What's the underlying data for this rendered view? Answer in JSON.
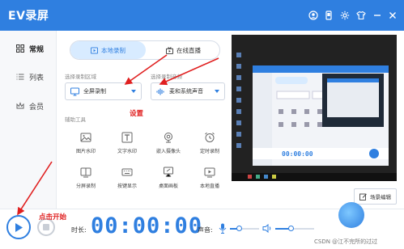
{
  "app": {
    "title": "EV录屏"
  },
  "titlebar": {
    "icons": [
      "user-icon",
      "phone-icon",
      "gear-icon",
      "shirt-icon",
      "minimize-icon",
      "close-icon"
    ]
  },
  "sidebar": {
    "items": [
      {
        "label": "常规",
        "icon": "grid-icon",
        "active": true
      },
      {
        "label": "列表",
        "icon": "list-icon",
        "active": false
      },
      {
        "label": "会员",
        "icon": "crown-icon",
        "active": false
      }
    ]
  },
  "mode_tabs": [
    {
      "label": "本地录制",
      "icon": "play-square-icon",
      "active": true
    },
    {
      "label": "在线直播",
      "icon": "broadcast-icon",
      "active": false
    }
  ],
  "record_area": {
    "label": "选择录制区域",
    "value": "全屏录制",
    "icon": "monitor-icon"
  },
  "record_audio": {
    "label": "选择录制音频",
    "value": "麦和系统声音",
    "icon": "sound-wave-icon"
  },
  "aux_tools": {
    "label": "辅助工具",
    "items": [
      {
        "label": "图片水印",
        "icon": "image-icon"
      },
      {
        "label": "文字水印",
        "icon": "text-icon"
      },
      {
        "label": "嵌入摄像头",
        "icon": "webcam-icon"
      },
      {
        "label": "定时录制",
        "icon": "alarm-icon"
      },
      {
        "label": "分屏录制",
        "icon": "split-screen-icon"
      },
      {
        "label": "按键显示",
        "icon": "keyboard-icon"
      },
      {
        "label": "桌面画板",
        "icon": "easel-icon"
      },
      {
        "label": "本地直播",
        "icon": "tv-icon"
      }
    ]
  },
  "preview": {
    "scene_button": "场景编辑"
  },
  "controls": {
    "duration_label": "时长:",
    "timer": "00:00:00",
    "volume_label": "声音:",
    "mic_level": 0.3,
    "speaker_level": 0.4
  },
  "annotations": {
    "settings": "设置",
    "start": "点击开始"
  },
  "watermark": "CSDN @江不完所的过过",
  "colors": {
    "primary": "#2f7fe0",
    "annotation": "#e02020"
  }
}
